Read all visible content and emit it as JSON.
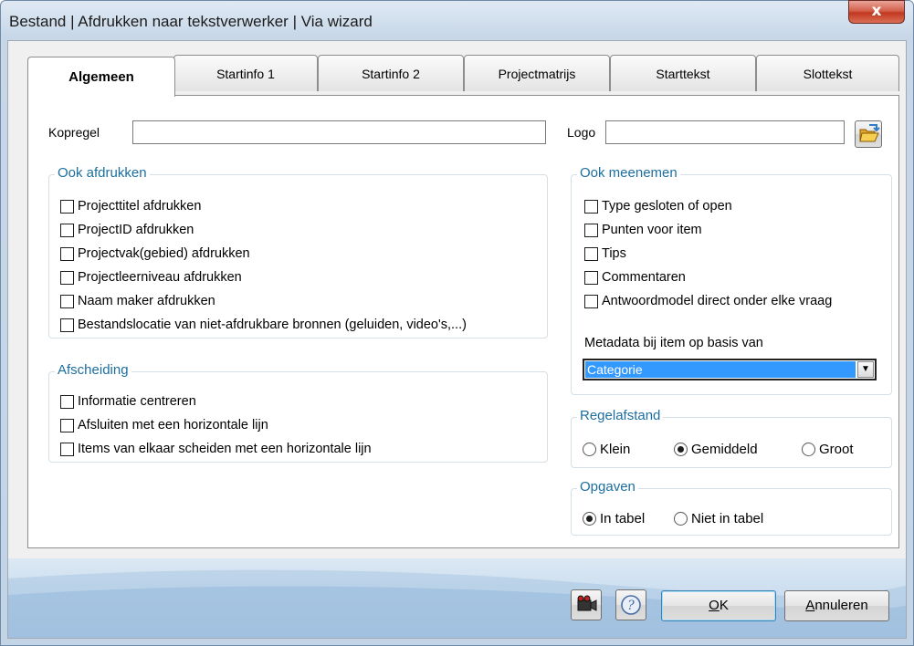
{
  "window": {
    "title": "Bestand | Afdrukken naar tekstverwerker | Via wizard",
    "close_label": "x"
  },
  "tabs": [
    {
      "label": "Algemeen",
      "active": true
    },
    {
      "label": "Startinfo 1"
    },
    {
      "label": "Startinfo 2"
    },
    {
      "label": "Projectmatrijs"
    },
    {
      "label": "Starttekst"
    },
    {
      "label": "Slottekst"
    }
  ],
  "kopregel": {
    "label": "Kopregel",
    "value": ""
  },
  "logo": {
    "label": "Logo",
    "value": ""
  },
  "ook_afdrukken": {
    "legend": "Ook afdrukken",
    "items": [
      {
        "label": "Projecttitel afdrukken",
        "checked": false
      },
      {
        "label": "ProjectID afdrukken",
        "checked": false
      },
      {
        "label": "Projectvak(gebied) afdrukken",
        "checked": false
      },
      {
        "label": "Projectleerniveau afdrukken",
        "checked": false
      },
      {
        "label": "Naam maker afdrukken",
        "checked": false
      },
      {
        "label": "Bestandslocatie van niet-afdrukbare bronnen (geluiden, video's,...)",
        "checked": false
      }
    ]
  },
  "afscheiding": {
    "legend": "Afscheiding",
    "items": [
      {
        "label": "Informatie centreren",
        "checked": false
      },
      {
        "label": "Afsluiten met een horizontale lijn",
        "checked": false
      },
      {
        "label": "Items van elkaar scheiden met een horizontale lijn",
        "checked": false
      }
    ]
  },
  "ook_meenemen": {
    "legend": "Ook meenemen",
    "items": [
      {
        "label": "Type gesloten of open",
        "checked": false
      },
      {
        "label": "Punten voor item",
        "checked": false
      },
      {
        "label": "Tips",
        "checked": false
      },
      {
        "label": "Commentaren",
        "checked": false
      },
      {
        "label": "Antwoordmodel direct onder elke vraag",
        "checked": false
      }
    ],
    "metadata_label": "Metadata bij item op basis van",
    "metadata_value": "Categorie"
  },
  "regelafstand": {
    "legend": "Regelafstand",
    "options": [
      "Klein",
      "Gemiddeld",
      "Groot"
    ],
    "selected": "Gemiddeld"
  },
  "opgaven": {
    "legend": "Opgaven",
    "options": [
      "In tabel",
      "Niet in tabel"
    ],
    "selected": "In tabel"
  },
  "buttons": {
    "ok_mnemonic": "O",
    "ok_rest": "K",
    "cancel_mnemonic": "A",
    "cancel_rest": "nnuleren"
  },
  "icons": {
    "logo_browse": "folder-open-icon",
    "video_help": "video-camera-icon",
    "help": "help-icon"
  },
  "colors": {
    "legend_text": "#1c6e9f",
    "select_highlight": "#3399ff",
    "close_button": "#c2371f"
  }
}
